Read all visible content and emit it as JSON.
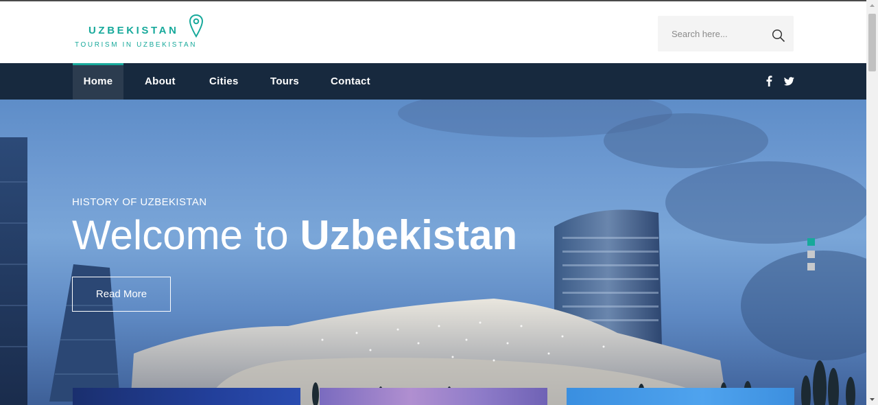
{
  "brand": {
    "name": "UZBEKISTAN",
    "tagline": "TOURISM IN UZBEKISTAN",
    "accent_color": "#17a99b"
  },
  "search": {
    "placeholder": "Search here...",
    "icon": "search-icon"
  },
  "nav": {
    "items": [
      {
        "label": "Home",
        "active": true
      },
      {
        "label": "About",
        "active": false
      },
      {
        "label": "Cities",
        "active": false
      },
      {
        "label": "Tours",
        "active": false
      },
      {
        "label": "Contact",
        "active": false
      }
    ],
    "social": [
      "facebook-icon",
      "twitter-icon"
    ],
    "background": "#17293e"
  },
  "hero": {
    "subtitle": "HISTORY OF UZBEKISTAN",
    "title_light": "Welcome to ",
    "title_bold": "Uzbekistan",
    "button_label": "Read More",
    "slides_total": 3,
    "active_slide": 1
  }
}
